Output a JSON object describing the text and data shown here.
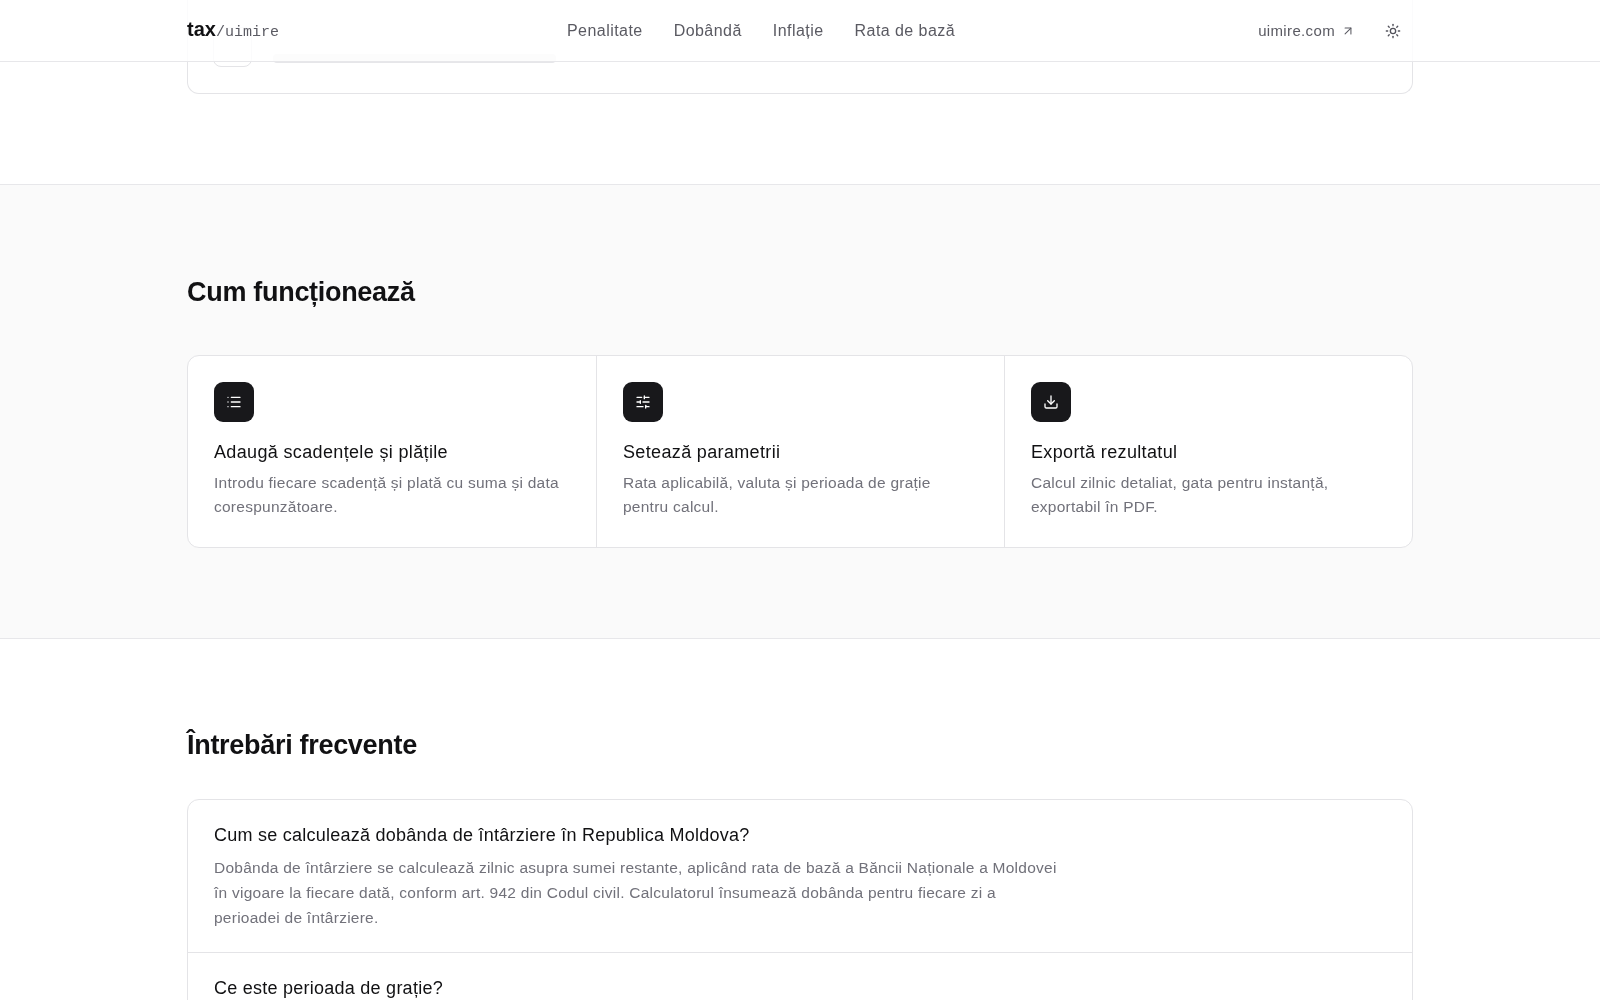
{
  "header": {
    "logo": {
      "primary": "tax",
      "secondary": "/uimire"
    },
    "nav": [
      {
        "label": "Penalitate",
        "selected": false
      },
      {
        "label": "Dobândă",
        "selected": false
      },
      {
        "label": "Inflație",
        "selected": false
      },
      {
        "label": "Rata de bază",
        "selected": false
      }
    ],
    "external_link": "uimire.com"
  },
  "how_it_works": {
    "title": "Cum funcționează",
    "steps": [
      {
        "title": "Adaugă scadențele și plățile",
        "description": "Introdu fiecare scadență și plată cu suma și data corespunzătoare."
      },
      {
        "title": "Setează parametrii",
        "description": "Rata aplicabilă, valuta și perioada de grație pentru calcul."
      },
      {
        "title": "Exportă rezultatul",
        "description": "Calcul zilnic detaliat, gata pentru instanță, exportabil în PDF."
      }
    ]
  },
  "faq": {
    "title": "Întrebări frecvente",
    "items": [
      {
        "question": "Cum se calculează dobânda de întârziere în Republica Moldova?",
        "answer": "Dobânda de întârziere se calculează zilnic asupra sumei restante, aplicând rata de bază a Băncii Naționale a Moldovei în vigoare la fiecare dată, conform art. 942 din Codul civil. Calculatorul însumează dobânda pentru fiecare zi a perioadei de întârziere."
      },
      {
        "question": "Ce este perioada de grație?"
      }
    ]
  }
}
